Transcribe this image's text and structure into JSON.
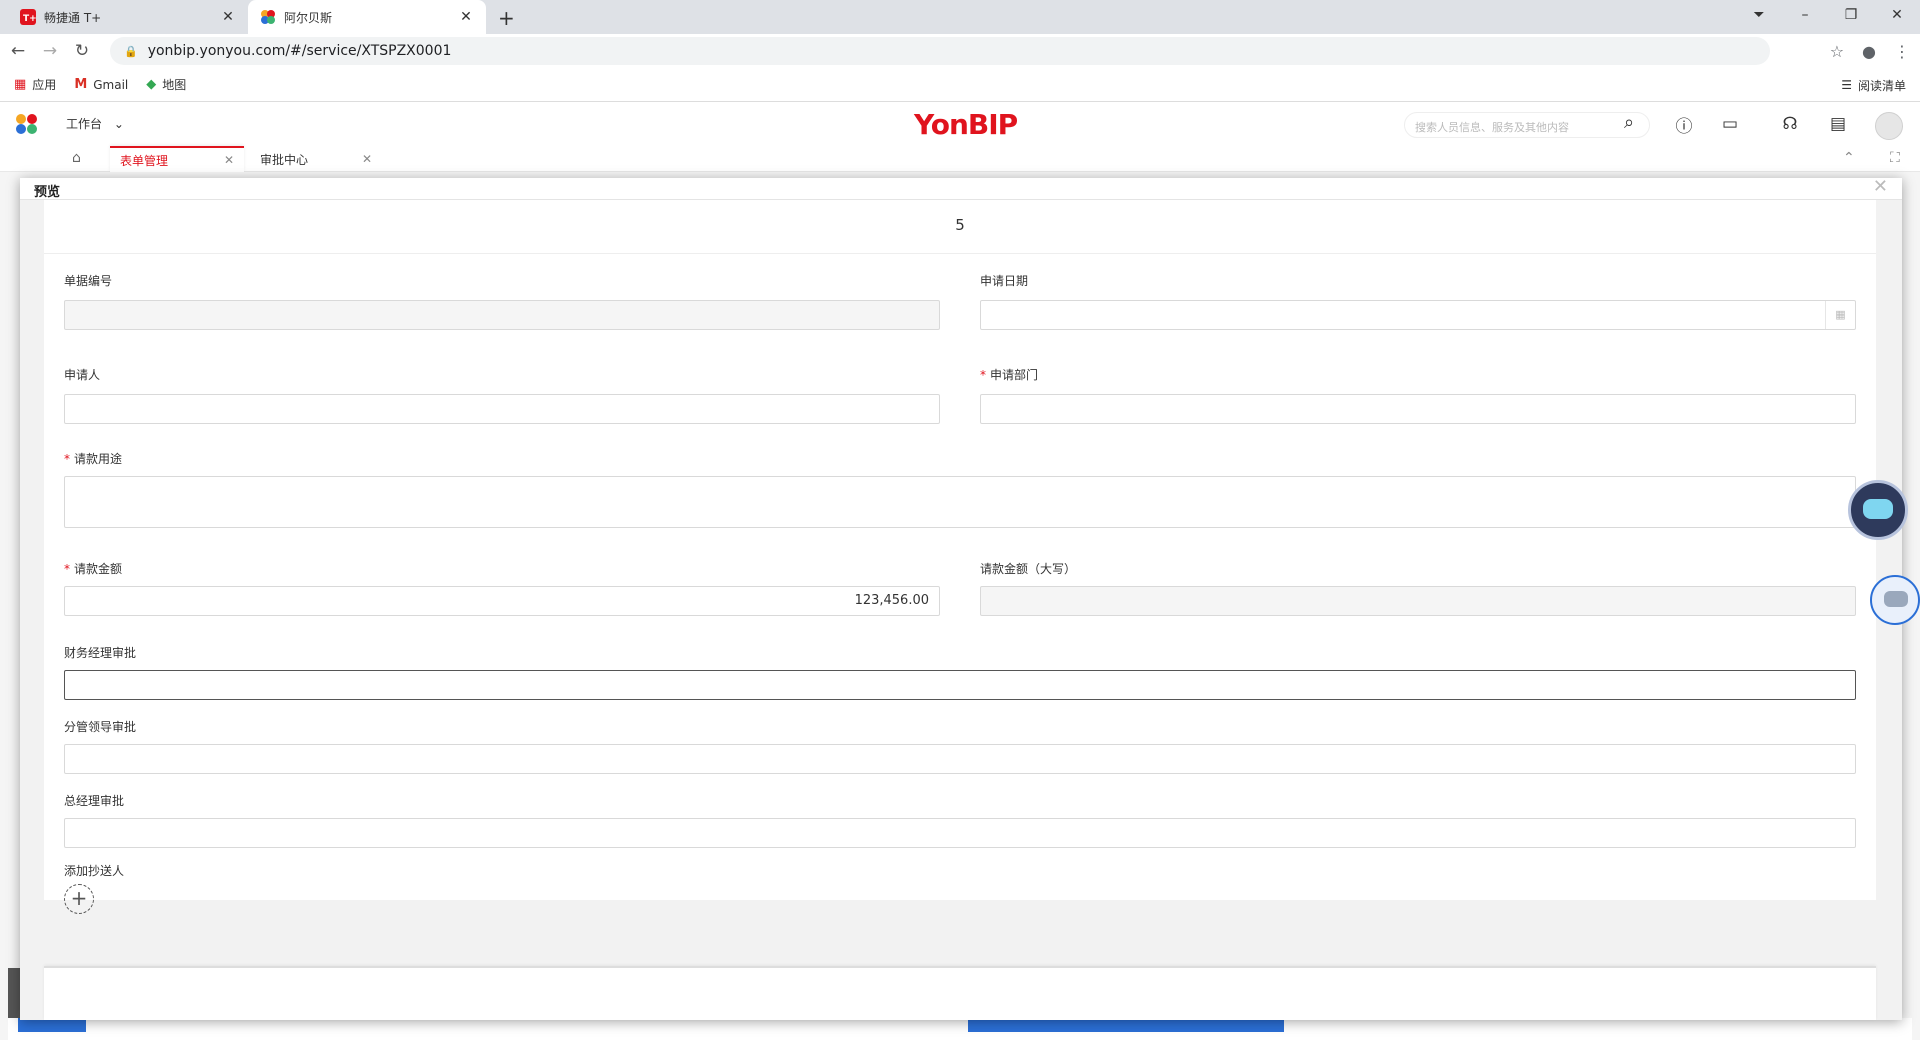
{
  "browser": {
    "tabs": [
      {
        "title": "畅捷通 T+",
        "active": false
      },
      {
        "title": "阿尔贝斯",
        "active": true
      }
    ],
    "url": "yonbip.yonyou.com/#/service/XTSPZX0001",
    "bookmarks": [
      {
        "label": "应用",
        "icon": "apps-grid-icon"
      },
      {
        "label": "Gmail",
        "icon": "gmail-icon"
      },
      {
        "label": "地图",
        "icon": "maps-icon"
      }
    ],
    "reading_list": "阅读清单"
  },
  "app": {
    "workbench": "工作台",
    "brand": "YonBIP",
    "search_placeholder": "搜索人员信息、服务及其他内容",
    "tabs": [
      {
        "label": "表单管理",
        "active": true
      },
      {
        "label": "审批中心",
        "active": false
      }
    ]
  },
  "modal": {
    "title": "预览",
    "form_number": "5",
    "fields": {
      "doc_no": {
        "label": "单据编号",
        "value": ""
      },
      "apply_date": {
        "label": "申请日期",
        "value": ""
      },
      "applicant": {
        "label": "申请人",
        "value": ""
      },
      "department": {
        "label": "申请部门",
        "value": "",
        "required": true
      },
      "purpose": {
        "label": "请款用途",
        "value": "",
        "required": true
      },
      "amount": {
        "label": "请款金额",
        "value": "123,456.00",
        "required": true
      },
      "amount_upper": {
        "label": "请款金额（大写）",
        "value": ""
      },
      "finance_approval": {
        "label": "财务经理审批",
        "value": ""
      },
      "leader_approval": {
        "label": "分管领导审批",
        "value": ""
      },
      "gm_approval": {
        "label": "总经理审批",
        "value": ""
      },
      "cc": {
        "label": "添加抄送人"
      }
    },
    "required_mark": "*"
  },
  "colors": {
    "brand_red": "#e0141e",
    "accent_blue": "#2b6fd6"
  }
}
